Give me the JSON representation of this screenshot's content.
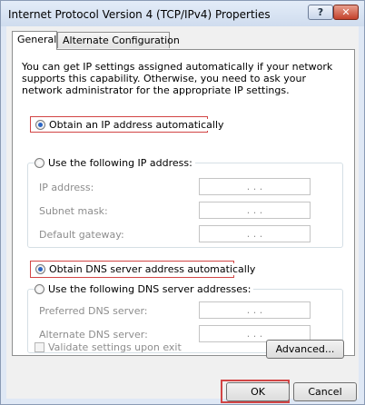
{
  "window": {
    "title": "Internet Protocol Version 4 (TCP/IPv4) Properties",
    "help_label": "?",
    "close_label": "✕"
  },
  "tabs": [
    {
      "label": "General"
    },
    {
      "label": "Alternate Configuration"
    }
  ],
  "description": "You can get IP settings assigned automatically if your network supports this capability. Otherwise, you need to ask your network administrator for the appropriate IP settings.",
  "ip": {
    "auto_label": "Obtain an IP address automatically",
    "manual_label": "Use the following IP address:",
    "fields": [
      {
        "label": "IP address:",
        "value": ". . ."
      },
      {
        "label": "Subnet mask:",
        "value": ". . ."
      },
      {
        "label": "Default gateway:",
        "value": ". . ."
      }
    ]
  },
  "dns": {
    "auto_label": "Obtain DNS server address automatically",
    "manual_label": "Use the following DNS server addresses:",
    "fields": [
      {
        "label": "Preferred DNS server:",
        "value": ". . ."
      },
      {
        "label": "Alternate DNS server:",
        "value": ". . ."
      }
    ]
  },
  "validate_label": "Validate settings upon exit",
  "buttons": {
    "advanced": "Advanced...",
    "ok": "OK",
    "cancel": "Cancel"
  },
  "colors": {
    "highlight": "#d24545",
    "disabled_text": "#8d8d8d",
    "radio_dot": "#2b65c4"
  }
}
